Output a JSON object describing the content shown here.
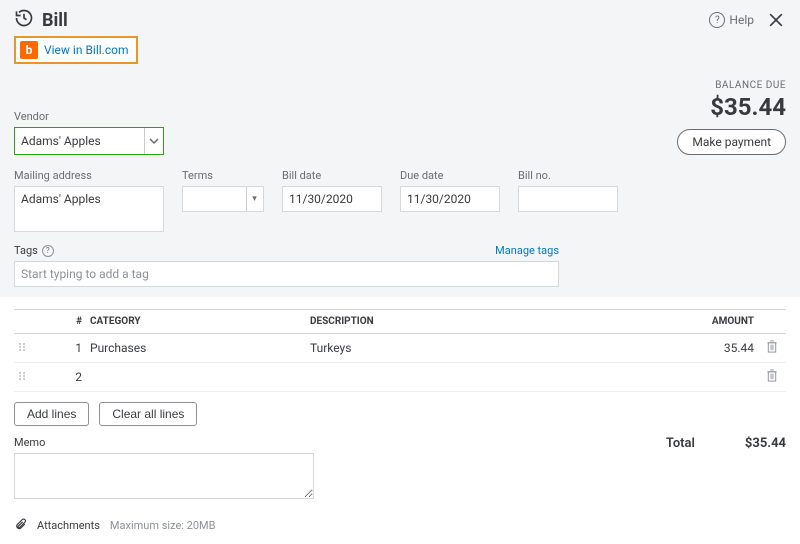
{
  "header": {
    "title": "Bill",
    "help_label": "Help"
  },
  "view_in_bill": {
    "badge_letter": "b",
    "label": "View in Bill.com"
  },
  "vendor": {
    "label": "Vendor",
    "value": "Adams' Apples"
  },
  "balance": {
    "label": "BALANCE DUE",
    "amount": "$35.44",
    "make_payment_label": "Make payment"
  },
  "fields": {
    "mailing_label": "Mailing address",
    "mailing_value": "Adams' Apples",
    "terms_label": "Terms",
    "terms_value": "",
    "bill_date_label": "Bill date",
    "bill_date_value": "11/30/2020",
    "due_date_label": "Due date",
    "due_date_value": "11/30/2020",
    "bill_no_label": "Bill no.",
    "bill_no_value": ""
  },
  "tags": {
    "label": "Tags",
    "manage_label": "Manage tags",
    "placeholder": "Start typing to add a tag"
  },
  "table": {
    "headers": {
      "num": "#",
      "category": "CATEGORY",
      "description": "DESCRIPTION",
      "amount": "AMOUNT"
    },
    "rows": [
      {
        "num": "1",
        "category": "Purchases",
        "description": "Turkeys",
        "amount": "35.44"
      },
      {
        "num": "2",
        "category": "",
        "description": "",
        "amount": ""
      }
    ]
  },
  "buttons": {
    "add_lines": "Add lines",
    "clear_all": "Clear all lines"
  },
  "memo": {
    "label": "Memo",
    "value": ""
  },
  "total": {
    "label": "Total",
    "value": "$35.44"
  },
  "attachments": {
    "label": "Attachments",
    "max_hint": "Maximum size: 20MB"
  }
}
